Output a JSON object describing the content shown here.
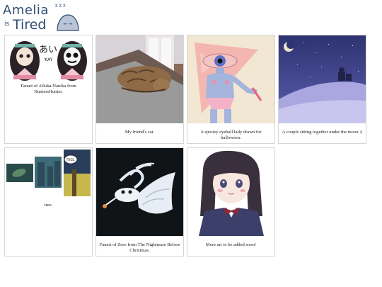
{
  "header": {
    "logo_line1": "Amelia",
    "logo_is": "is",
    "logo_line2": "Tired",
    "logo_zz": "z z z"
  },
  "gallery": [
    {
      "caption": "Fanart of Alluka/Nanika from HuntersHunter.",
      "image_text_1": "あい",
      "image_text_2": "'KAY"
    },
    {
      "caption": "My friend's cat."
    },
    {
      "caption": "A spooky eyeball lady drawn for halloween."
    },
    {
      "caption": "A couple sitting together under the moon :)"
    },
    {
      "caption": "tree.",
      "image_text_1": "TREE."
    },
    {
      "caption": "Fanart of Zero from The Nightmare Before Christmas."
    },
    {
      "caption": "More art to be added soon!"
    }
  ]
}
